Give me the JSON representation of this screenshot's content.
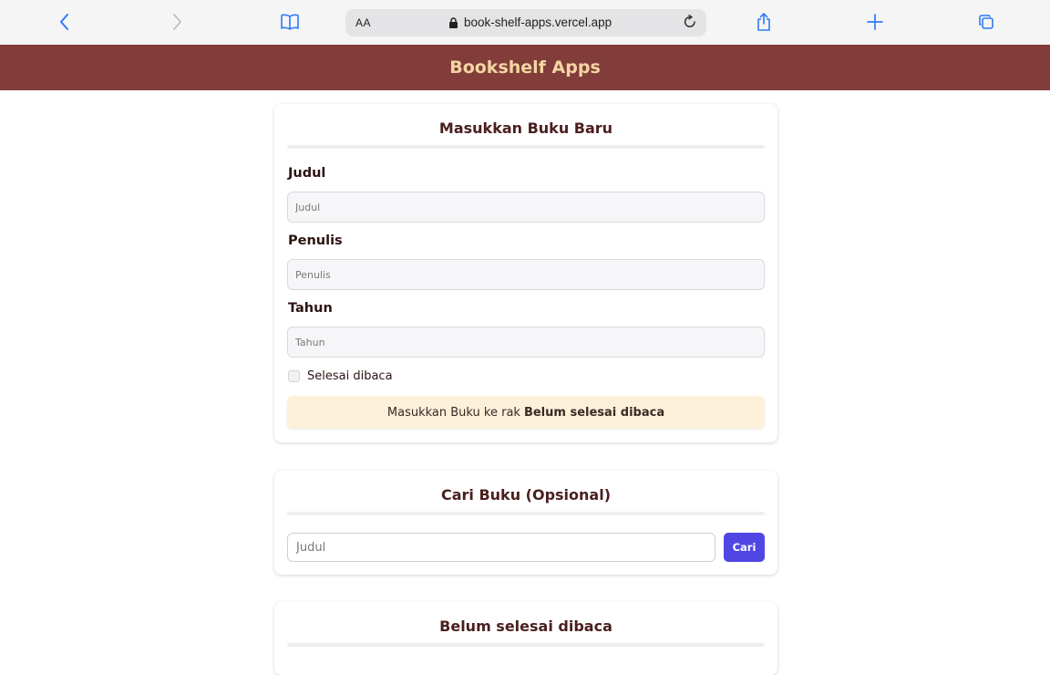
{
  "browser": {
    "text_size_label": "AA",
    "url": "book-shelf-apps.vercel.app",
    "icons": [
      "back-icon",
      "forward-icon",
      "bookmarks-icon",
      "lock-icon",
      "reload-icon",
      "share-icon",
      "new-tab-icon",
      "tabs-icon"
    ]
  },
  "header": {
    "title": "Bookshelf Apps"
  },
  "add_form": {
    "title": "Masukkan Buku Baru",
    "fields": [
      {
        "label": "Judul",
        "placeholder": "Judul"
      },
      {
        "label": "Penulis",
        "placeholder": "Penulis"
      },
      {
        "label": "Tahun",
        "placeholder": "Tahun"
      }
    ],
    "checkbox_label": "Selesai dibaca",
    "checkbox_checked": false,
    "submit_prefix": "Masukkan Buku ke rak",
    "submit_target": "Belum selesai dibaca"
  },
  "search": {
    "title": "Cari Buku (Opsional)",
    "placeholder": "Judul",
    "button_label": "Cari"
  },
  "unread_shelf": {
    "title": "Belum selesai dibaca"
  },
  "colors": {
    "header_bg": "#823d3b",
    "header_text": "#f4d6a3",
    "submit_bg": "#fdf0d9",
    "search_button": "#5046e4",
    "browser_accent": "#2f7bf5"
  }
}
